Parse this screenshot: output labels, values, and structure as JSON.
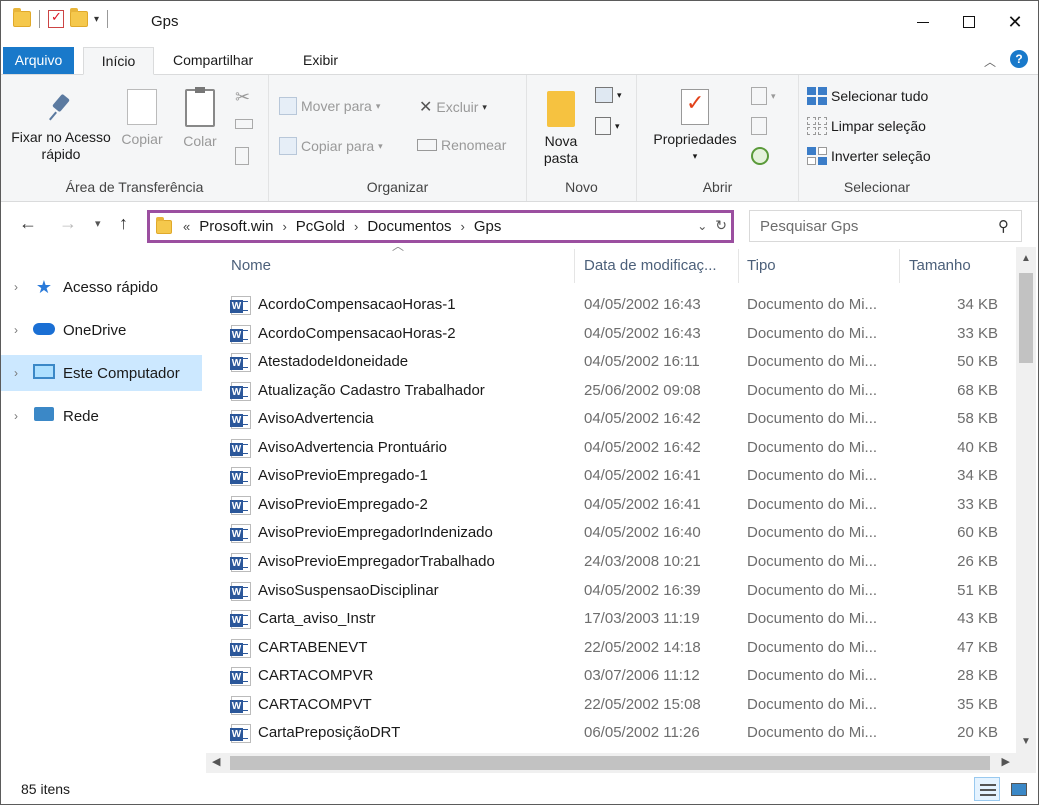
{
  "window": {
    "title": "Gps",
    "accent_color": "#1979ca",
    "highlight_color": "#9b4fa0"
  },
  "ribbon_tabs": {
    "file": "Arquivo",
    "home": "Início",
    "share": "Compartilhar",
    "view": "Exibir"
  },
  "ribbon": {
    "clipboard": {
      "pin_label": "Fixar no Acesso rápido",
      "copy": "Copiar",
      "paste": "Colar",
      "group": "Área de Transferência"
    },
    "organize": {
      "move_to": "Mover para",
      "copy_to": "Copiar para",
      "delete": "Excluir",
      "rename": "Renomear",
      "group": "Organizar"
    },
    "new": {
      "new_folder": "Nova pasta",
      "group": "Novo"
    },
    "open": {
      "properties": "Propriedades",
      "group": "Abrir"
    },
    "select": {
      "select_all": "Selecionar tudo",
      "select_none": "Limpar seleção",
      "invert": "Inverter seleção",
      "group": "Selecionar"
    }
  },
  "address": {
    "prefix": "«",
    "crumbs": [
      "Prosoft.win",
      "PcGold",
      "Documentos",
      "Gps"
    ]
  },
  "search": {
    "placeholder": "Pesquisar Gps"
  },
  "navpane": {
    "items": [
      {
        "label": "Acesso rápido",
        "icon": "star-icon"
      },
      {
        "label": "OneDrive",
        "icon": "cloud-icon"
      },
      {
        "label": "Este Computador",
        "icon": "computer-icon",
        "selected": true
      },
      {
        "label": "Rede",
        "icon": "network-icon"
      }
    ]
  },
  "columns": {
    "name": "Nome",
    "date": "Data de modificaç...",
    "type": "Tipo",
    "size": "Tamanho"
  },
  "files": [
    {
      "name": "AcordoCompensacaoHoras-1",
      "date": "04/05/2002 16:43",
      "type": "Documento do Mi...",
      "size": "34 KB"
    },
    {
      "name": "AcordoCompensacaoHoras-2",
      "date": "04/05/2002 16:43",
      "type": "Documento do Mi...",
      "size": "33 KB"
    },
    {
      "name": "AtestadodeIdoneidade",
      "date": "04/05/2002 16:11",
      "type": "Documento do Mi...",
      "size": "50 KB"
    },
    {
      "name": "Atualização Cadastro Trabalhador",
      "date": "25/06/2002 09:08",
      "type": "Documento do Mi...",
      "size": "68 KB"
    },
    {
      "name": "AvisoAdvertencia",
      "date": "04/05/2002 16:42",
      "type": "Documento do Mi...",
      "size": "58 KB"
    },
    {
      "name": "AvisoAdvertencia Prontuário",
      "date": "04/05/2002 16:42",
      "type": "Documento do Mi...",
      "size": "40 KB"
    },
    {
      "name": "AvisoPrevioEmpregado-1",
      "date": "04/05/2002 16:41",
      "type": "Documento do Mi...",
      "size": "34 KB"
    },
    {
      "name": "AvisoPrevioEmpregado-2",
      "date": "04/05/2002 16:41",
      "type": "Documento do Mi...",
      "size": "33 KB"
    },
    {
      "name": "AvisoPrevioEmpregadorIndenizado",
      "date": "04/05/2002 16:40",
      "type": "Documento do Mi...",
      "size": "60 KB"
    },
    {
      "name": "AvisoPrevioEmpregadorTrabalhado",
      "date": "24/03/2008 10:21",
      "type": "Documento do Mi...",
      "size": "26 KB"
    },
    {
      "name": "AvisoSuspensaoDisciplinar",
      "date": "04/05/2002 16:39",
      "type": "Documento do Mi...",
      "size": "51 KB"
    },
    {
      "name": "Carta_aviso_Instr",
      "date": "17/03/2003 11:19",
      "type": "Documento do Mi...",
      "size": "43 KB"
    },
    {
      "name": "CARTABENEVT",
      "date": "22/05/2002 14:18",
      "type": "Documento do Mi...",
      "size": "47 KB"
    },
    {
      "name": "CARTACOMPVR",
      "date": "03/07/2006 11:12",
      "type": "Documento do Mi...",
      "size": "28 KB"
    },
    {
      "name": "CARTACOMPVT",
      "date": "22/05/2002 15:08",
      "type": "Documento do Mi...",
      "size": "35 KB"
    },
    {
      "name": "CartaPreposiçãoDRT",
      "date": "06/05/2002 11:26",
      "type": "Documento do Mi...",
      "size": "20 KB"
    }
  ],
  "status": {
    "item_count": "85 itens"
  }
}
